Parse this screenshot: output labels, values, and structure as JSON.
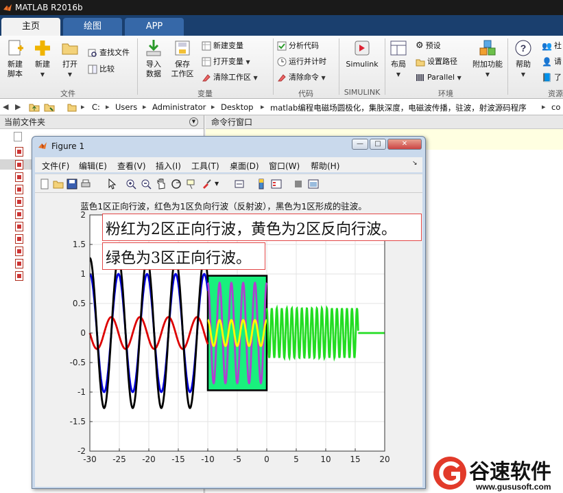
{
  "window": {
    "title": "MATLAB R2016b"
  },
  "ribbon_tabs": [
    "主页",
    "绘图",
    "APP"
  ],
  "ribbon": {
    "new_script": [
      "新建",
      "脚本"
    ],
    "new": "新建",
    "open": "打开",
    "find_files": "查找文件",
    "compare": "比较",
    "import_data": [
      "导入",
      "数据"
    ],
    "save_workspace": [
      "保存",
      "工作区"
    ],
    "new_variable": "新建变量",
    "open_variable": "打开变量",
    "clear_workspace": "清除工作区",
    "analyze_code": "分析代码",
    "run_and_time": "运行并计时",
    "clear_commands": "清除命令",
    "simulink": "Simulink",
    "layout": "布局",
    "preferences": "预设",
    "set_path": "设置路径",
    "parallel": "Parallel",
    "addons": "附加功能",
    "help": "帮助",
    "community_partial": "社",
    "request_partial": "请",
    "learn_partial": "了",
    "groups": {
      "file": "文件",
      "variable": "变量",
      "code": "代码",
      "simulink": "SIMULINK",
      "environment": "环境",
      "resources": "资源"
    }
  },
  "path_segments": [
    "C:",
    "Users",
    "Administrator",
    "Desktop",
    "matlab编程电磁场圆极化，集肤深度，电磁波传播，驻波，射波源码程序",
    "co"
  ],
  "panels": {
    "current_folder": "当前文件夹",
    "command_window": "命令行窗口"
  },
  "figure": {
    "title": "Figure 1",
    "menu": [
      "文件(F)",
      "编辑(E)",
      "查看(V)",
      "插入(I)",
      "工具(T)",
      "桌面(D)",
      "窗口(W)",
      "帮助(H)"
    ],
    "toolbar_icons": [
      "new-figure-icon",
      "open-file-icon",
      "save-icon",
      "print-icon",
      "pointer-icon",
      "zoom-in-icon",
      "zoom-out-icon",
      "pan-icon",
      "rotate-icon",
      "data-cursor-icon",
      "brush-icon",
      "link-icon",
      "colorbar-icon",
      "legend-icon",
      "hide-tools-icon",
      "dock-icon"
    ],
    "window_buttons": [
      "—",
      "□",
      "✕"
    ]
  },
  "watermark": {
    "brand": "谷速软件",
    "url": "www.gususoft.com"
  },
  "chart_data": {
    "type": "line",
    "title": "蓝色1区正向行波，红色为1区负向行波（反射波），黑色为1区形成的驻波。",
    "annotations": [
      "粉红为2区正向行波，黄色为2区反向行波。",
      "绿色为3区正向行波。"
    ],
    "xlim": [
      -30,
      20
    ],
    "ylim": [
      -2,
      2
    ],
    "xticks": [
      -30,
      -25,
      -20,
      -15,
      -10,
      -5,
      0,
      5,
      10,
      15,
      20
    ],
    "yticks": [
      -2,
      -1.5,
      -1,
      -0.5,
      0,
      0.5,
      1,
      1.5,
      2
    ],
    "grid": true,
    "region2_box": {
      "x": [
        -10,
        0
      ],
      "y": [
        -0.97,
        0.97
      ],
      "fill": "#19f07d"
    },
    "series": [
      {
        "color": "#0000dd",
        "region": [
          -30,
          -10
        ],
        "amplitude": 1.0,
        "period": 4.85
      },
      {
        "color": "#dd0000",
        "region": [
          -30,
          -10
        ],
        "amplitude": 0.27,
        "period": 4.85
      },
      {
        "color": "#000000",
        "region": [
          -30,
          -10
        ],
        "amplitude": 1.27,
        "period": 4.85
      },
      {
        "color": "#b040d0",
        "region": [
          -10,
          0
        ],
        "amplitude": 0.85,
        "period": 2.0
      },
      {
        "color": "#ffff00",
        "region": [
          -10,
          0
        ],
        "amplitude": 0.22,
        "period": 2.0
      },
      {
        "color": "#22dd22",
        "region": [
          0,
          15.5
        ],
        "amplitude": 0.42,
        "period": 0.85
      },
      {
        "color": "#22dd22",
        "region": [
          15.5,
          20
        ],
        "amplitude": 0,
        "period": 1
      }
    ]
  }
}
